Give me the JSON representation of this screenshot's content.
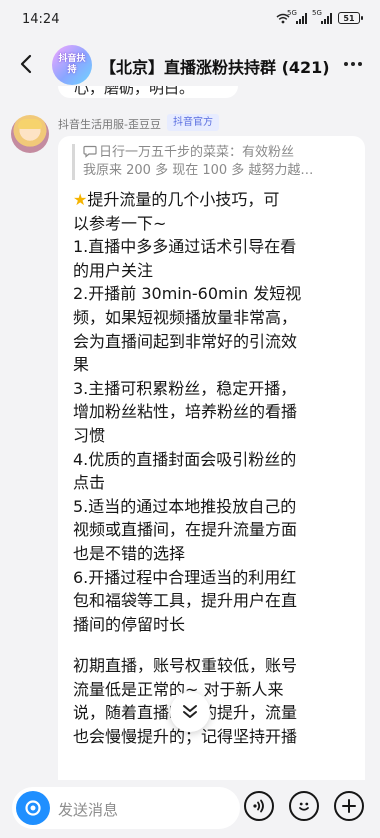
{
  "status": {
    "time": "14:24",
    "signal_a": "5G",
    "signal_b": "5G",
    "battery": "51"
  },
  "header": {
    "title": "【北京】直播涨粉扶持群 (421)",
    "avatar_text": "抖音扶持"
  },
  "previous_message": {
    "text": "心，磨砺，明白。"
  },
  "message": {
    "sender_name": "抖音生活用服-歪豆豆",
    "sender_badge": "抖音官方",
    "quote_lines": [
      "日行一万五千步的菜菜：有效粉丝",
      "我原来 200 多 现在 100 多 越努力越…"
    ],
    "lines": [
      "提升流量的几个小技巧，可",
      "以参考一下~",
      "1.直播中多多通过话术引导在看",
      "的用户关注",
      "2.开播前 30min-60min 发短视",
      "频，如果短视频播放量非常高，",
      "会为直播间起到非常好的引流效",
      "果",
      "3.主播可积累粉丝，稳定开播，",
      "增加粉丝粘性，培养粉丝的看播",
      "习惯",
      "4.优质的直播封面会吸引粉丝的",
      "点击",
      "5.适当的通过本地推投放自己的",
      "视频或直播间，在提升流量方面",
      "也是不错的选择",
      "6.开播过程中合理适当的利用红",
      "包和福袋等工具，提升用户在直",
      "播间的停留时长"
    ],
    "lines_after": [
      "初期直播，账号权重较低，账号",
      "流量低是正常的~ 对于新人来",
      "说，随着直播时长的提升，流量",
      "也会慢慢提升的；记得坚持开播"
    ]
  },
  "input": {
    "placeholder": "发送消息"
  },
  "icons": {
    "back": "back-arrow-icon",
    "more": "more-dots-icon",
    "star": "star-emoji-icon",
    "quote": "chat-bubble-icon",
    "scroll": "double-chevron-down-icon",
    "camera": "camera-icon",
    "voice": "voice-icon",
    "emoji": "emoji-icon",
    "plus": "plus-icon"
  },
  "colors": {
    "background": "#f3f3f5",
    "bubble": "#ffffff",
    "badge_text": "#5b6fe0",
    "badge_bg": "#e7ecff",
    "camera_button": "#1f8fff",
    "star": "#f5b400"
  }
}
